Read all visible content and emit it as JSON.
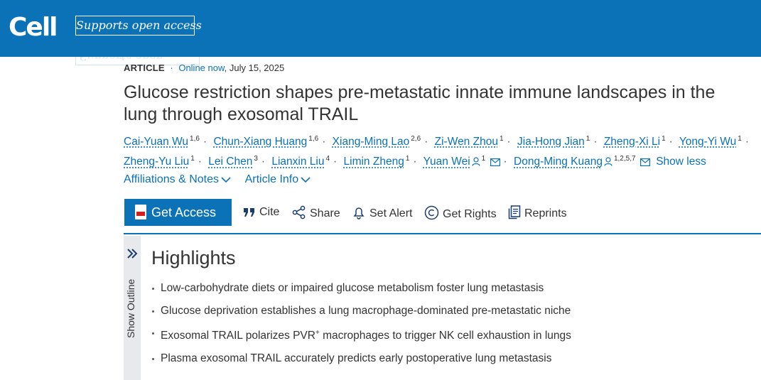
{
  "header": {
    "logo": "Cell",
    "badge": "Supports open access",
    "colors": {
      "brand": "#0b72b8"
    }
  },
  "article": {
    "type": "ARTICLE",
    "online_label": "Online now",
    "date": "July 15, 2025",
    "title": "Glucose restriction shapes pre-metastatic innate immune landscapes in the lung through exosomal TRAIL"
  },
  "authors": [
    {
      "name": "Cai-Yuan Wu",
      "aff": "1,6"
    },
    {
      "name": "Chun-Xiang Huang",
      "aff": "1,6"
    },
    {
      "name": "Xiang-Ming Lao",
      "aff": "2,6"
    },
    {
      "name": "Zi-Wen Zhou",
      "aff": "1"
    },
    {
      "name": "Jia-Hong Jian",
      "aff": "1"
    },
    {
      "name": "Zheng-Xi Li",
      "aff": "1"
    },
    {
      "name": "Yong-Yi Wu",
      "aff": "1"
    },
    {
      "name": "Zheng-Yu Liu",
      "aff": "1"
    },
    {
      "name": "Lei Chen",
      "aff": "3"
    },
    {
      "name": "Lianxin Liu",
      "aff": "4"
    },
    {
      "name": "Limin Zheng",
      "aff": "1"
    },
    {
      "name": "Yuan Wei",
      "aff": "1"
    },
    {
      "name": "Dong-Ming Kuang",
      "aff": "1,2,5,7"
    }
  ],
  "show_less": "Show less",
  "info_links": {
    "affiliations": "Affiliations & Notes",
    "article_info": "Article Info"
  },
  "toolbar": {
    "get_access": "Get Access",
    "cite": "Cite",
    "share": "Share",
    "set_alert": "Set Alert",
    "get_rights": "Get Rights",
    "reprints": "Reprints"
  },
  "outline": {
    "label": "Show Outline"
  },
  "highlights": {
    "title": "Highlights",
    "items": [
      "Low-carbohydrate diets or impaired glucose metabolism foster lung metastasis",
      "Glucose deprivation establishes a lung macrophage-dominated pre-metastatic niche",
      "Plasma exosomal TRAIL accurately predicts early postoperative lung metastasis"
    ],
    "item3_prefix": "Exosomal TRAIL polarizes PVR",
    "item3_sup": "+",
    "item3_suffix": " macrophages to trigger NK cell exhaustion in lungs"
  }
}
